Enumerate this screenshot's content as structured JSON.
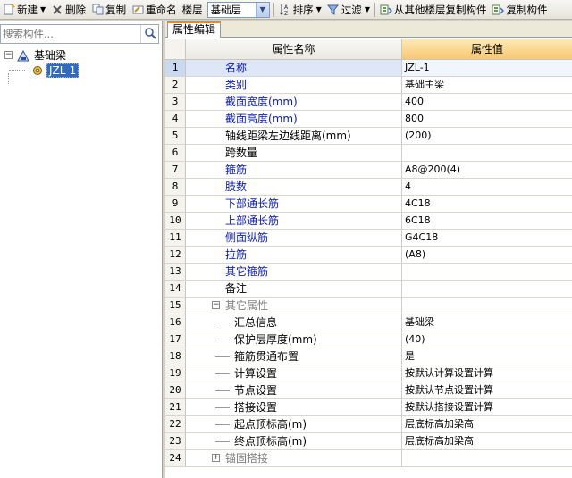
{
  "toolbar": {
    "new_label": "新建",
    "delete_label": "删除",
    "copy_label": "复制",
    "rename_label": "重命名",
    "floor_label": "楼层",
    "floor_value": "基础层",
    "sort_label": "排序",
    "filter_label": "过滤",
    "copy_from_floor_label": "从其他楼层复制构件",
    "copy_to_label": "复制构件"
  },
  "search": {
    "placeholder": "搜索构件..."
  },
  "tree": {
    "root_label": "基础梁",
    "child_label": "JZL-1"
  },
  "tab": {
    "label": "属性编辑"
  },
  "grid": {
    "col_name": "属性名称",
    "col_value": "属性值",
    "rows": [
      {
        "n": "1",
        "name": "名称",
        "value": "JZL-1"
      },
      {
        "n": "2",
        "name": "类别",
        "value": "基础主梁"
      },
      {
        "n": "3",
        "name": "截面宽度(mm)",
        "value": "400"
      },
      {
        "n": "4",
        "name": "截面高度(mm)",
        "value": "800"
      },
      {
        "n": "5",
        "name": "轴线距梁左边线距离(mm)",
        "value": "(200)"
      },
      {
        "n": "6",
        "name": "跨数量",
        "value": ""
      },
      {
        "n": "7",
        "name": "箍筋",
        "value": "A8@200(4)"
      },
      {
        "n": "8",
        "name": "肢数",
        "value": "4"
      },
      {
        "n": "9",
        "name": "下部通长筋",
        "value": "4C18"
      },
      {
        "n": "10",
        "name": "上部通长筋",
        "value": "6C18"
      },
      {
        "n": "11",
        "name": "侧面纵筋",
        "value": "G4C18"
      },
      {
        "n": "12",
        "name": "拉筋",
        "value": "(A8)"
      },
      {
        "n": "13",
        "name": "其它箍筋",
        "value": ""
      },
      {
        "n": "14",
        "name": "备注",
        "value": ""
      },
      {
        "n": "15",
        "name": "其它属性",
        "value": "",
        "expander": "−"
      },
      {
        "n": "16",
        "name": "汇总信息",
        "value": "基础梁"
      },
      {
        "n": "17",
        "name": "保护层厚度(mm)",
        "value": "(40)"
      },
      {
        "n": "18",
        "name": "箍筋贯通布置",
        "value": "是"
      },
      {
        "n": "19",
        "name": "计算设置",
        "value": "按默认计算设置计算"
      },
      {
        "n": "20",
        "name": "节点设置",
        "value": "按默认节点设置计算"
      },
      {
        "n": "21",
        "name": "搭接设置",
        "value": "按默认搭接设置计算"
      },
      {
        "n": "22",
        "name": "起点顶标高(m)",
        "value": "层底标高加梁高"
      },
      {
        "n": "23",
        "name": "终点顶标高(m)",
        "value": "层底标高加梁高"
      },
      {
        "n": "24",
        "name": "锚固搭接",
        "value": "",
        "expander": "+"
      }
    ]
  },
  "colors": {
    "blue_label": "#0b1cbb",
    "header_value_bg": "#f7c872",
    "selection": "#316ac5"
  }
}
